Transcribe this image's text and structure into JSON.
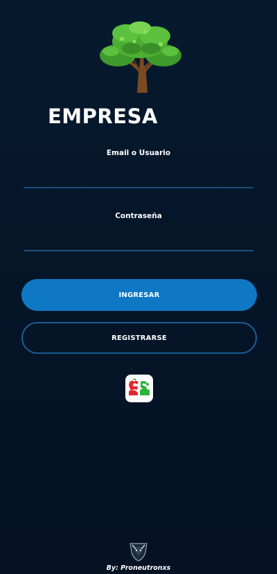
{
  "brand": {
    "title": "EMPRESA",
    "logo_icon": "tree-icon"
  },
  "login_form": {
    "email_label": "Email o Usuario",
    "email_value": "",
    "password_label": "Contraseña",
    "password_value": "",
    "submit_label": "INGRESAR",
    "register_label": "REGISTRARSE"
  },
  "app_badge": {
    "icon": "app-logo-icon"
  },
  "footer": {
    "credit": "By: Proneutronxs",
    "logo_icon": "proneutronxs-logo-icon"
  },
  "colors": {
    "background": "#061629",
    "primary": "#0e78c4",
    "outline": "#1b5c91",
    "underline": "#1e4d7a",
    "text": "#ffffff"
  }
}
